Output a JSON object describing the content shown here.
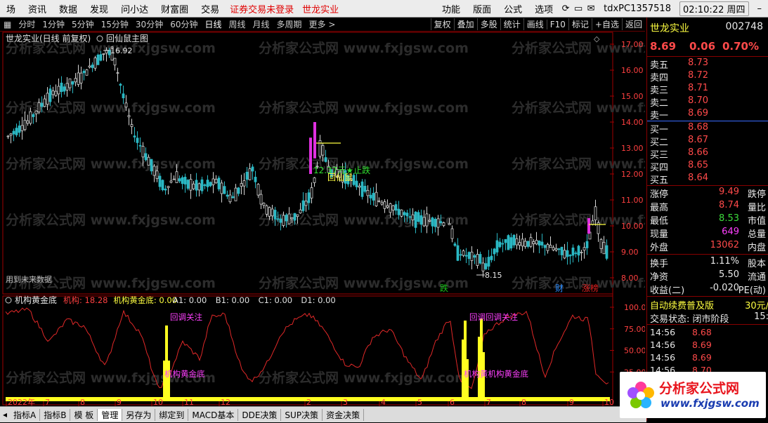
{
  "menu": {
    "items": [
      "场",
      "资讯",
      "数据",
      "发现",
      "问小达",
      "财富圈",
      "交易"
    ],
    "warning": "证券交易未登录",
    "stock": "世龙实业",
    "right_items": [
      "功能",
      "版面",
      "公式",
      "选项"
    ],
    "account": "tdxPC1357518",
    "clock": "02:10:22 周四"
  },
  "periods": [
    "分时",
    "1分钟",
    "5分钟",
    "15分钟",
    "30分钟",
    "60分钟",
    "日线",
    "周线",
    "月线",
    "多周期",
    "更多 >"
  ],
  "active_period": "日线",
  "toolbar": [
    "复权",
    "叠加",
    "多股",
    "统计",
    "画线",
    "F10",
    "标记",
    "+自选",
    "返回"
  ],
  "main": {
    "title": "世龙实业(日线 前复权)",
    "indicator_name": "回仙鼠主图",
    "watermark": "分析家公式网 www.fxjgsw.com",
    "price_labels": [
      "17.00",
      "16.00",
      "15.00",
      "14.00",
      "13.00",
      "12.00",
      "11.00",
      "10.00",
      "9.00",
      "8.00"
    ],
    "high_label": "16.92",
    "low_label": "8.15",
    "annot_stop": "12.37元★止跌",
    "annot_rat": "回仙鼠",
    "future_text": "用到未来数据",
    "event_tags": [
      {
        "text": "跌",
        "color": "#18c018"
      },
      {
        "text": "财",
        "color": "#2a8cff"
      },
      {
        "text": "涨榜",
        "color": "#e02020"
      }
    ]
  },
  "sub": {
    "name": "机构黄金底",
    "header_vals": [
      {
        "text": "机构: 18.28",
        "color": "#ff4040"
      },
      {
        "text": "机构黄金底: 0.00",
        "color": "#ffff40"
      },
      {
        "text": "A1: 0.00",
        "color": "#e0e0e0"
      },
      {
        "text": "B1: 0.00",
        "color": "#e0e0e0"
      },
      {
        "text": "C1: 0.00",
        "color": "#e0e0e0"
      },
      {
        "text": "D1: 0.00",
        "color": "#e0e0e0"
      }
    ],
    "ylabels": [
      "100.0",
      "75.00",
      "50.00",
      "25.00"
    ],
    "sig_top_1": "回调关注",
    "sig_bot_1": "机构黄金底",
    "sig_top_2": "回调回调关注",
    "sig_bot_2": "机构黄机构黄金底",
    "xaxis": [
      "2022年",
      "7",
      "8",
      "9",
      "10",
      "11",
      "12",
      "2",
      "3",
      "4",
      "5",
      "6",
      "7",
      "8",
      "9",
      "10"
    ]
  },
  "quote": {
    "name": "世龙实业",
    "code": "002748",
    "price": "8.69",
    "change": "0.06",
    "pct": "0.70%",
    "asks": [
      [
        "卖五",
        "8.73"
      ],
      [
        "卖四",
        "8.72"
      ],
      [
        "卖三",
        "8.71"
      ],
      [
        "卖二",
        "8.70"
      ],
      [
        "卖一",
        "8.69"
      ]
    ],
    "bids": [
      [
        "买一",
        "8.68"
      ],
      [
        "买二",
        "8.67"
      ],
      [
        "买三",
        "8.66"
      ],
      [
        "买四",
        "8.65"
      ],
      [
        "买五",
        "8.64"
      ]
    ],
    "stats": [
      {
        "l": "涨停",
        "v": "9.49",
        "c": "red",
        "r": "跌停"
      },
      {
        "l": "最高",
        "v": "8.74",
        "c": "red",
        "r": "量比"
      },
      {
        "l": "最低",
        "v": "8.53",
        "c": "grn",
        "r": "市值"
      },
      {
        "l": "现量",
        "v": "649",
        "c": "mag",
        "r": "总量"
      },
      {
        "l": "外盘",
        "v": "13062",
        "c": "red",
        "r": "内盘"
      },
      {
        "l": "换手",
        "v": "1.11%",
        "c": "wht",
        "r": "股本"
      },
      {
        "l": "净资",
        "v": "5.50",
        "c": "wht",
        "r": "流通"
      },
      {
        "l": "收益(二)",
        "v": "-0.020",
        "c": "wht",
        "r": "PE(动)"
      }
    ],
    "promo": "自动续费普及版",
    "promo_price": "30元/",
    "trade_state": "交易状态: 闭市阶段",
    "trade_state_tail": "15:",
    "ticks": [
      [
        "14:56",
        "8.68"
      ],
      [
        "14:56",
        "8.69"
      ],
      [
        "14:56",
        "8.69"
      ],
      [
        "14:56",
        "8.70"
      ],
      [
        "14:56",
        "8.69"
      ]
    ]
  },
  "tabs": [
    "指标A",
    "指标B",
    "模 板",
    "管理",
    "另存为",
    "绑定到",
    "MACD基本",
    "DDE决策",
    "SUP决策",
    "资金决策"
  ],
  "active_tab": "管理",
  "logo": {
    "name": "分析家公式网",
    "url": "www.fxjgsw.com"
  }
}
